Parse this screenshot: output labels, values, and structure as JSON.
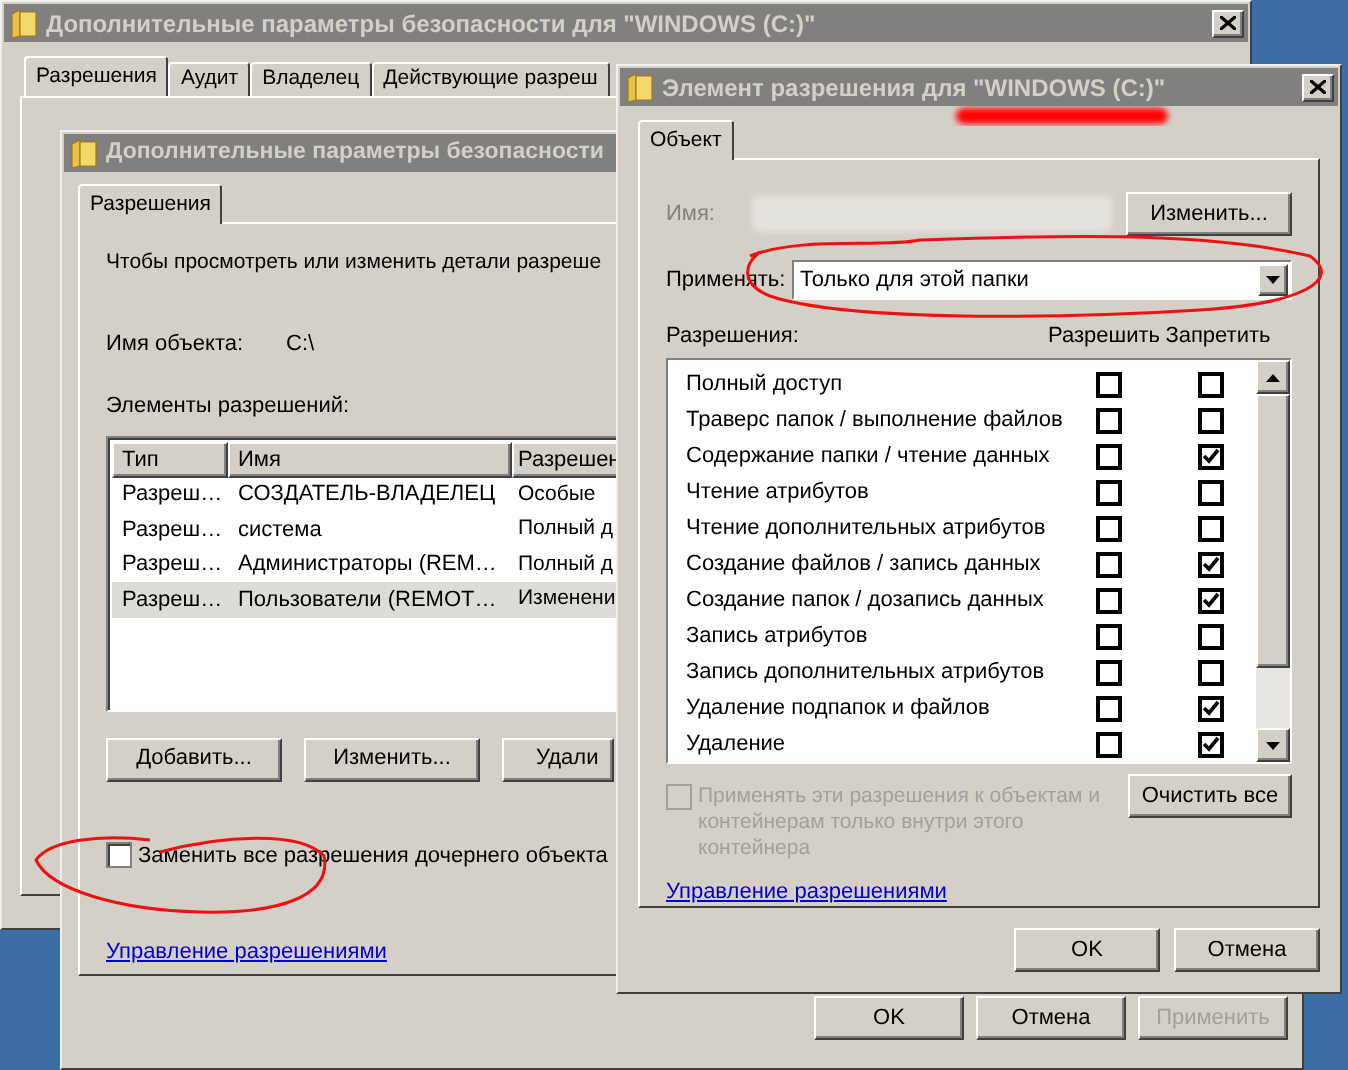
{
  "back_window": {
    "title": "Дополнительные параметры безопасности  для \"WINDOWS (C:)\"",
    "tabs": [
      {
        "label": "Разрешения",
        "selected": true
      },
      {
        "label": "Аудит",
        "selected": false
      },
      {
        "label": "Владелец",
        "selected": false
      },
      {
        "label": "Действующие разреш",
        "selected": false
      }
    ]
  },
  "advanced_window": {
    "title": "Дополнительные параметры безопасности",
    "tabs": [
      {
        "label": "Разрешения",
        "selected": true
      }
    ],
    "intro": "Чтобы просмотреть или изменить детали разреше",
    "object_name_label": "Имя объекта:",
    "object_name": "C:\\",
    "entries_label": "Элементы разрешений:",
    "table": {
      "columns": [
        "Тип",
        "Имя",
        "Разрешен"
      ],
      "rows": [
        {
          "cells": [
            "Разреш…",
            "СОЗДАТЕЛЬ-ВЛАДЕЛЕЦ",
            "Особые"
          ],
          "selected": false
        },
        {
          "cells": [
            "Разреш…",
            "система",
            "Полный д"
          ],
          "selected": false
        },
        {
          "cells": [
            "Разреш…",
            "Администраторы (REM…",
            "Полный д"
          ],
          "selected": false
        },
        {
          "cells": [
            "Разреш…",
            "Пользователи (REMOT…",
            "Изменени"
          ],
          "selected": true
        }
      ]
    },
    "buttons": [
      "Добавить...",
      "Изменить...",
      "Удали"
    ],
    "replace_checkbox": {
      "label": "Заменить все разрешения дочернего объекта",
      "checked": false
    },
    "link": "Управление разрешениями",
    "footer_buttons": [
      {
        "label": "OK",
        "disabled": false
      },
      {
        "label": "Отмена",
        "disabled": false
      },
      {
        "label": "Применить",
        "disabled": true
      }
    ]
  },
  "entry_window": {
    "title": "Элемент разрешения для \"WINDOWS (C:)\"",
    "tabs": [
      {
        "label": "Объект",
        "selected": true
      }
    ],
    "name_label": "Имя:",
    "change_button": "Изменить...",
    "apply_label": "Применять:",
    "apply_value": "Только для этой папки",
    "permissions_label": "Разрешения:",
    "allow_header": "Разрешить",
    "deny_header": "Запретить",
    "permissions": [
      {
        "name": "Полный доступ",
        "allow": false,
        "deny": false
      },
      {
        "name": "Траверс папок / выполнение файлов",
        "allow": false,
        "deny": false
      },
      {
        "name": "Содержание папки / чтение данных",
        "allow": false,
        "deny": true
      },
      {
        "name": "Чтение атрибутов",
        "allow": false,
        "deny": false
      },
      {
        "name": "Чтение дополнительных атрибутов",
        "allow": false,
        "deny": false
      },
      {
        "name": "Создание файлов / запись данных",
        "allow": false,
        "deny": true
      },
      {
        "name": "Создание папок / дозапись данных",
        "allow": false,
        "deny": true
      },
      {
        "name": "Запись атрибутов",
        "allow": false,
        "deny": false
      },
      {
        "name": "Запись дополнительных атрибутов",
        "allow": false,
        "deny": false
      },
      {
        "name": "Удаление подпапок и файлов",
        "allow": false,
        "deny": true
      },
      {
        "name": "Удаление",
        "allow": false,
        "deny": true
      }
    ],
    "inherit_checkbox": {
      "label": "Применять эти разрешения к объектам и контейнерам только внутри этого контейнера",
      "checked": false,
      "disabled": true
    },
    "clear_button": "Очистить все",
    "link": "Управление разрешениями",
    "footer_buttons": [
      {
        "label": "OK"
      },
      {
        "label": "Отмена"
      }
    ]
  }
}
